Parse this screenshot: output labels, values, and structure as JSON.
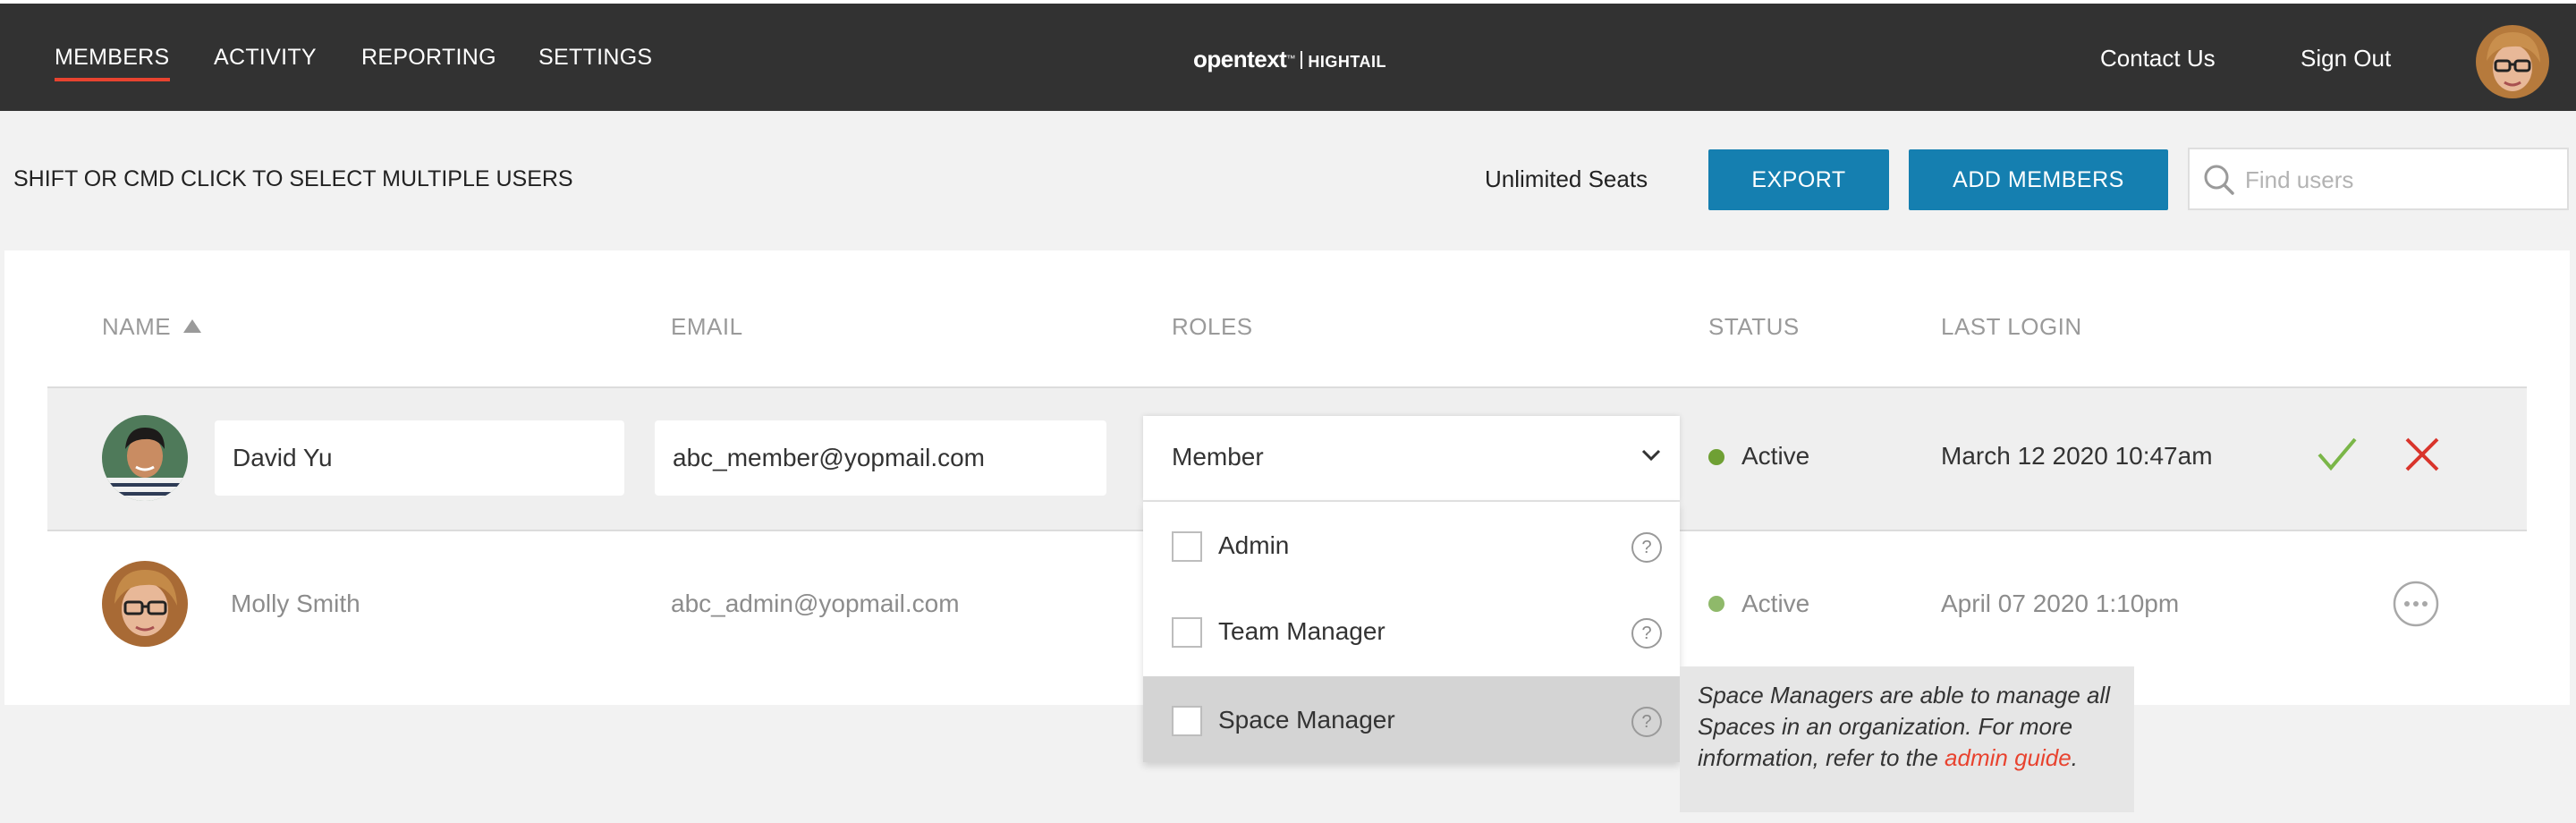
{
  "nav": {
    "items": [
      "MEMBERS",
      "ACTIVITY",
      "REPORTING",
      "SETTINGS"
    ],
    "active": "MEMBERS",
    "logo_brand": "opentext",
    "logo_tm": "™",
    "logo_product": "HIGHTAIL",
    "contact_label": "Contact Us",
    "signout_label": "Sign Out"
  },
  "toolbar": {
    "hint": "SHIFT OR CMD CLICK TO SELECT MULTIPLE USERS",
    "seats": "Unlimited Seats",
    "export_label": "EXPORT",
    "add_label": "ADD MEMBERS",
    "search_placeholder": "Find users"
  },
  "table": {
    "columns": [
      "NAME",
      "EMAIL",
      "ROLES",
      "STATUS",
      "LAST LOGIN"
    ],
    "sort_column": "NAME",
    "rows": [
      {
        "name": "David Yu",
        "email": "abc_member@yopmail.com",
        "role": "Member",
        "status": "Active",
        "last_login": "March 12 2020 10:47am",
        "editing": true
      },
      {
        "name": "Molly Smith",
        "email": "abc_admin@yopmail.com",
        "status": "Active",
        "last_login": "April 07 2020 1:10pm",
        "editing": false
      }
    ]
  },
  "roles_dropdown": {
    "selected": "Member",
    "options": [
      {
        "label": "Admin",
        "checked": false
      },
      {
        "label": "Team Manager",
        "checked": false
      },
      {
        "label": "Space Manager",
        "checked": false,
        "highlighted": true
      }
    ],
    "help_glyph": "?"
  },
  "tooltip": {
    "text": "Space Managers are able to manage all Spaces in an organization. For more information, refer to the ",
    "link": "admin guide",
    "suffix": "."
  },
  "colors": {
    "nav_bg": "#323232",
    "accent_red": "#e8432f",
    "button_blue": "#157fb0",
    "status_green": "#6fa034",
    "confirm_green": "#7ab648",
    "cancel_red": "#d9342b"
  }
}
